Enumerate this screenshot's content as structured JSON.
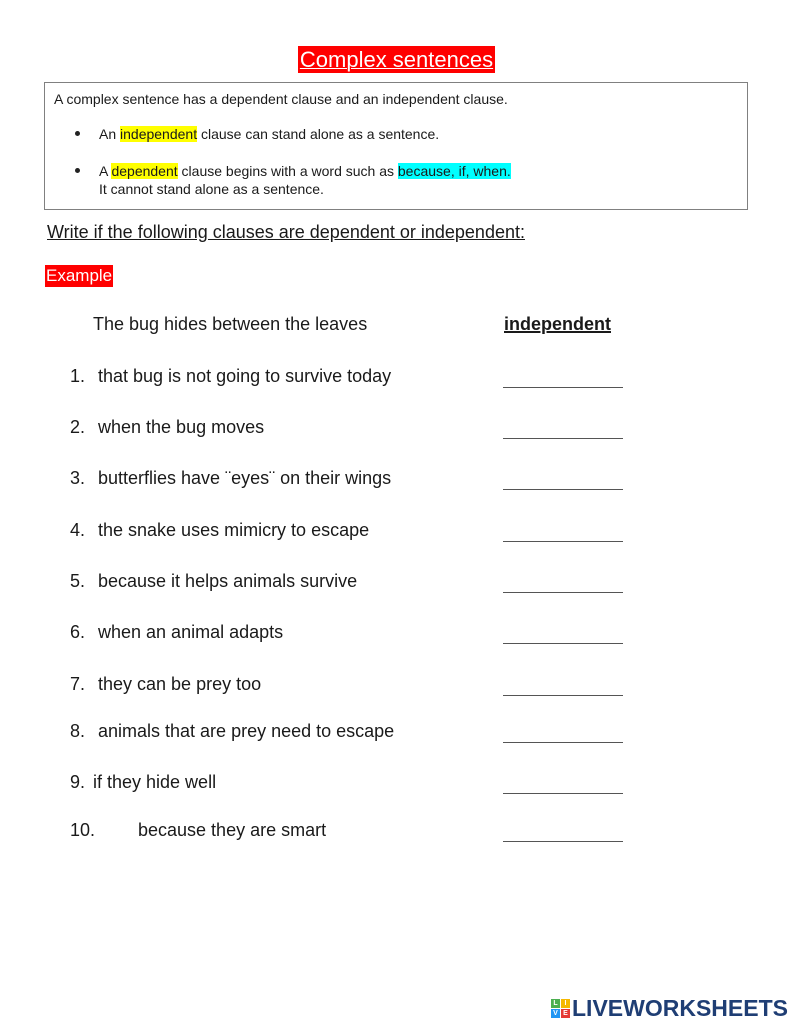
{
  "title": "Complex sentences",
  "info_box": {
    "intro": "A complex sentence has a dependent clause and an independent clause.",
    "bullet1": {
      "pre": "An ",
      "highlight": "independent",
      "post": " clause can stand alone as a sentence."
    },
    "bullet2": {
      "pre": "A ",
      "highlight": "dependent",
      "mid": " clause begins with a word such as ",
      "highlight2": "because, if, when.",
      "line2": "It cannot stand alone as a sentence."
    }
  },
  "instructions": "Write if the following clauses are dependent or independent:",
  "example": {
    "label": "Example",
    "clause": "The bug hides between the leaves",
    "answer": "independent"
  },
  "items": [
    {
      "num": "1.",
      "clause": "that bug is not going to survive today",
      "answer": ""
    },
    {
      "num": "2.",
      "clause": "when the bug moves",
      "answer": ""
    },
    {
      "num": "3.",
      "clause": "butterflies have ¨eyes¨ on their wings",
      "answer": ""
    },
    {
      "num": "4.",
      "clause": "the snake uses mimicry to escape",
      "answer": ""
    },
    {
      "num": "5.",
      "clause": "because it helps animals survive",
      "answer": ""
    },
    {
      "num": "6.",
      "clause": "when an animal adapts",
      "answer": ""
    },
    {
      "num": "7.",
      "clause": "they can be prey too",
      "answer": ""
    },
    {
      "num": "8.",
      "clause": "animals that are prey need to escape",
      "answer": ""
    },
    {
      "num": "9.",
      "clause": "if they hide well",
      "answer": ""
    },
    {
      "num": "10.",
      "clause": "because they are smart",
      "answer": ""
    }
  ],
  "footer": {
    "logo_letters": [
      "L",
      "I",
      "V",
      "E"
    ],
    "logo_colors": [
      "#4caf50",
      "#f5b800",
      "#2196f3",
      "#e53935"
    ],
    "logo_text": "LIVEWORKSHEETS"
  }
}
